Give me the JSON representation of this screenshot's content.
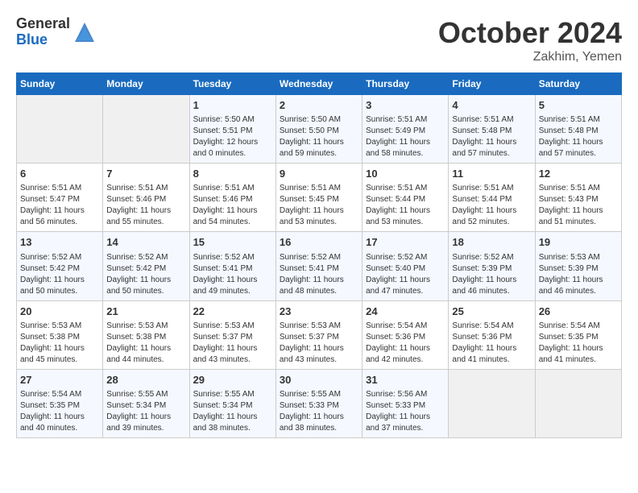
{
  "logo": {
    "general": "General",
    "blue": "Blue"
  },
  "title": "October 2024",
  "location": "Zakhim, Yemen",
  "days_header": [
    "Sunday",
    "Monday",
    "Tuesday",
    "Wednesday",
    "Thursday",
    "Friday",
    "Saturday"
  ],
  "weeks": [
    [
      {
        "day": "",
        "sunrise": "",
        "sunset": "",
        "daylight": ""
      },
      {
        "day": "",
        "sunrise": "",
        "sunset": "",
        "daylight": ""
      },
      {
        "day": "1",
        "sunrise": "Sunrise: 5:50 AM",
        "sunset": "Sunset: 5:51 PM",
        "daylight": "Daylight: 12 hours and 0 minutes."
      },
      {
        "day": "2",
        "sunrise": "Sunrise: 5:50 AM",
        "sunset": "Sunset: 5:50 PM",
        "daylight": "Daylight: 11 hours and 59 minutes."
      },
      {
        "day": "3",
        "sunrise": "Sunrise: 5:51 AM",
        "sunset": "Sunset: 5:49 PM",
        "daylight": "Daylight: 11 hours and 58 minutes."
      },
      {
        "day": "4",
        "sunrise": "Sunrise: 5:51 AM",
        "sunset": "Sunset: 5:48 PM",
        "daylight": "Daylight: 11 hours and 57 minutes."
      },
      {
        "day": "5",
        "sunrise": "Sunrise: 5:51 AM",
        "sunset": "Sunset: 5:48 PM",
        "daylight": "Daylight: 11 hours and 57 minutes."
      }
    ],
    [
      {
        "day": "6",
        "sunrise": "Sunrise: 5:51 AM",
        "sunset": "Sunset: 5:47 PM",
        "daylight": "Daylight: 11 hours and 56 minutes."
      },
      {
        "day": "7",
        "sunrise": "Sunrise: 5:51 AM",
        "sunset": "Sunset: 5:46 PM",
        "daylight": "Daylight: 11 hours and 55 minutes."
      },
      {
        "day": "8",
        "sunrise": "Sunrise: 5:51 AM",
        "sunset": "Sunset: 5:46 PM",
        "daylight": "Daylight: 11 hours and 54 minutes."
      },
      {
        "day": "9",
        "sunrise": "Sunrise: 5:51 AM",
        "sunset": "Sunset: 5:45 PM",
        "daylight": "Daylight: 11 hours and 53 minutes."
      },
      {
        "day": "10",
        "sunrise": "Sunrise: 5:51 AM",
        "sunset": "Sunset: 5:44 PM",
        "daylight": "Daylight: 11 hours and 53 minutes."
      },
      {
        "day": "11",
        "sunrise": "Sunrise: 5:51 AM",
        "sunset": "Sunset: 5:44 PM",
        "daylight": "Daylight: 11 hours and 52 minutes."
      },
      {
        "day": "12",
        "sunrise": "Sunrise: 5:51 AM",
        "sunset": "Sunset: 5:43 PM",
        "daylight": "Daylight: 11 hours and 51 minutes."
      }
    ],
    [
      {
        "day": "13",
        "sunrise": "Sunrise: 5:52 AM",
        "sunset": "Sunset: 5:42 PM",
        "daylight": "Daylight: 11 hours and 50 minutes."
      },
      {
        "day": "14",
        "sunrise": "Sunrise: 5:52 AM",
        "sunset": "Sunset: 5:42 PM",
        "daylight": "Daylight: 11 hours and 50 minutes."
      },
      {
        "day": "15",
        "sunrise": "Sunrise: 5:52 AM",
        "sunset": "Sunset: 5:41 PM",
        "daylight": "Daylight: 11 hours and 49 minutes."
      },
      {
        "day": "16",
        "sunrise": "Sunrise: 5:52 AM",
        "sunset": "Sunset: 5:41 PM",
        "daylight": "Daylight: 11 hours and 48 minutes."
      },
      {
        "day": "17",
        "sunrise": "Sunrise: 5:52 AM",
        "sunset": "Sunset: 5:40 PM",
        "daylight": "Daylight: 11 hours and 47 minutes."
      },
      {
        "day": "18",
        "sunrise": "Sunrise: 5:52 AM",
        "sunset": "Sunset: 5:39 PM",
        "daylight": "Daylight: 11 hours and 46 minutes."
      },
      {
        "day": "19",
        "sunrise": "Sunrise: 5:53 AM",
        "sunset": "Sunset: 5:39 PM",
        "daylight": "Daylight: 11 hours and 46 minutes."
      }
    ],
    [
      {
        "day": "20",
        "sunrise": "Sunrise: 5:53 AM",
        "sunset": "Sunset: 5:38 PM",
        "daylight": "Daylight: 11 hours and 45 minutes."
      },
      {
        "day": "21",
        "sunrise": "Sunrise: 5:53 AM",
        "sunset": "Sunset: 5:38 PM",
        "daylight": "Daylight: 11 hours and 44 minutes."
      },
      {
        "day": "22",
        "sunrise": "Sunrise: 5:53 AM",
        "sunset": "Sunset: 5:37 PM",
        "daylight": "Daylight: 11 hours and 43 minutes."
      },
      {
        "day": "23",
        "sunrise": "Sunrise: 5:53 AM",
        "sunset": "Sunset: 5:37 PM",
        "daylight": "Daylight: 11 hours and 43 minutes."
      },
      {
        "day": "24",
        "sunrise": "Sunrise: 5:54 AM",
        "sunset": "Sunset: 5:36 PM",
        "daylight": "Daylight: 11 hours and 42 minutes."
      },
      {
        "day": "25",
        "sunrise": "Sunrise: 5:54 AM",
        "sunset": "Sunset: 5:36 PM",
        "daylight": "Daylight: 11 hours and 41 minutes."
      },
      {
        "day": "26",
        "sunrise": "Sunrise: 5:54 AM",
        "sunset": "Sunset: 5:35 PM",
        "daylight": "Daylight: 11 hours and 41 minutes."
      }
    ],
    [
      {
        "day": "27",
        "sunrise": "Sunrise: 5:54 AM",
        "sunset": "Sunset: 5:35 PM",
        "daylight": "Daylight: 11 hours and 40 minutes."
      },
      {
        "day": "28",
        "sunrise": "Sunrise: 5:55 AM",
        "sunset": "Sunset: 5:34 PM",
        "daylight": "Daylight: 11 hours and 39 minutes."
      },
      {
        "day": "29",
        "sunrise": "Sunrise: 5:55 AM",
        "sunset": "Sunset: 5:34 PM",
        "daylight": "Daylight: 11 hours and 38 minutes."
      },
      {
        "day": "30",
        "sunrise": "Sunrise: 5:55 AM",
        "sunset": "Sunset: 5:33 PM",
        "daylight": "Daylight: 11 hours and 38 minutes."
      },
      {
        "day": "31",
        "sunrise": "Sunrise: 5:56 AM",
        "sunset": "Sunset: 5:33 PM",
        "daylight": "Daylight: 11 hours and 37 minutes."
      },
      {
        "day": "",
        "sunrise": "",
        "sunset": "",
        "daylight": ""
      },
      {
        "day": "",
        "sunrise": "",
        "sunset": "",
        "daylight": ""
      }
    ]
  ]
}
